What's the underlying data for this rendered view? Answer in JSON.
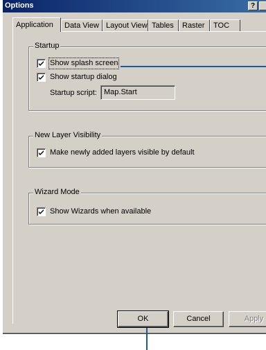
{
  "window": {
    "title": "Options",
    "help_button": "?"
  },
  "tabs": [
    {
      "label": "Application"
    },
    {
      "label": "Data View"
    },
    {
      "label": "Layout View"
    },
    {
      "label": "Tables"
    },
    {
      "label": "Raster"
    },
    {
      "label": "TOC"
    }
  ],
  "startup": {
    "group_label": "Startup",
    "show_splash": {
      "label": "Show splash screen",
      "checked": true
    },
    "show_dialog": {
      "label": "Show startup dialog",
      "checked": true
    },
    "script_label": "Startup script:",
    "script_value": "Map.Start"
  },
  "layer_visibility": {
    "group_label": "New Layer Visibility",
    "make_visible": {
      "label": "Make newly added layers visible by default",
      "checked": true
    }
  },
  "wizard_mode": {
    "group_label": "Wizard Mode",
    "show_wizards": {
      "label": "Show Wizards when available",
      "checked": true
    }
  },
  "buttons": {
    "ok": "OK",
    "cancel": "Cancel",
    "apply": "Apply"
  },
  "colors": {
    "titlebar": "#0a246a",
    "face": "#d4d0c8",
    "callout_line": "#1a5aa0"
  }
}
